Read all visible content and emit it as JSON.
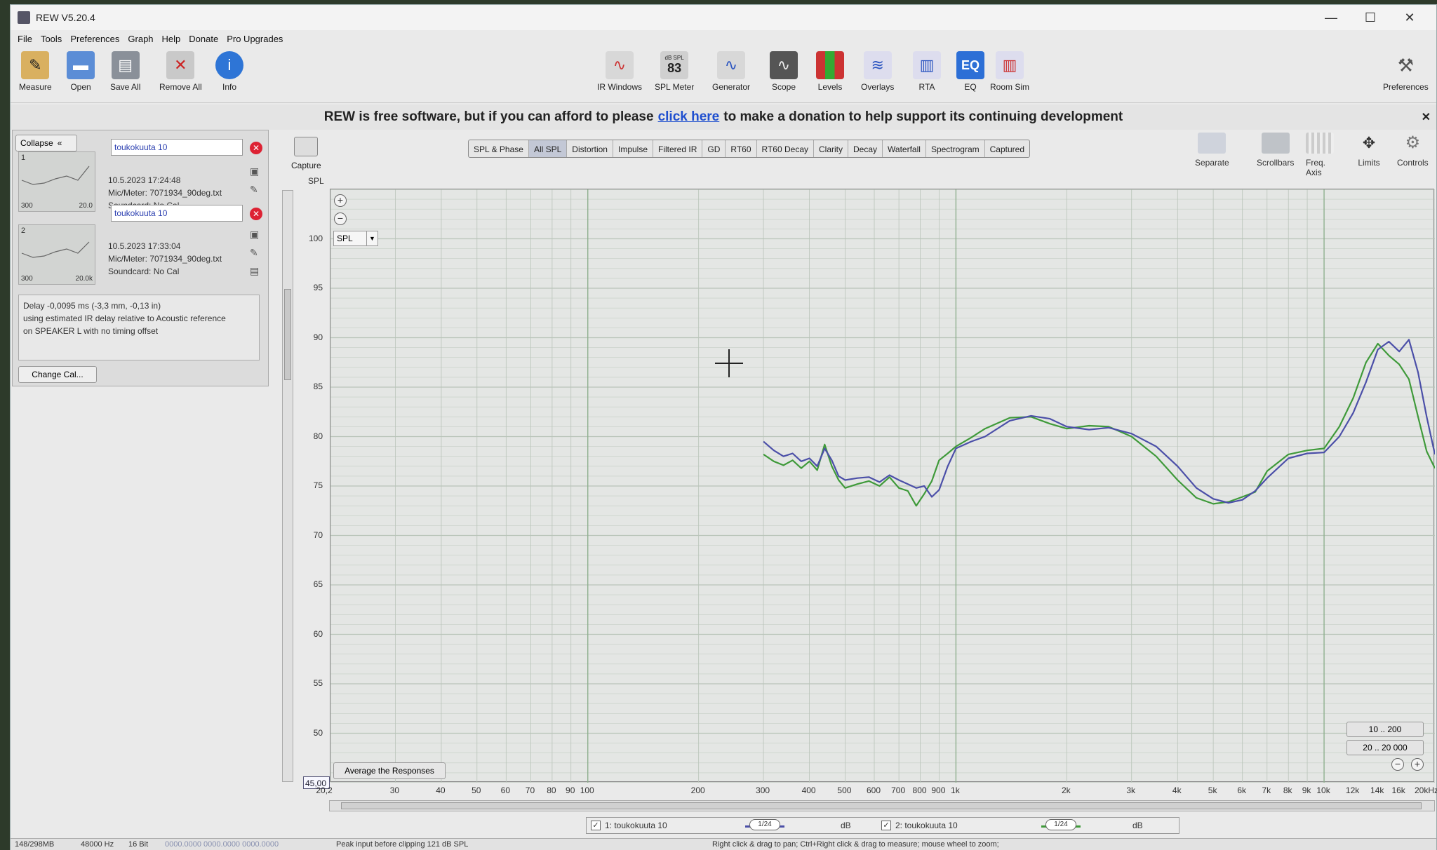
{
  "window": {
    "title": "REW V5.20.4",
    "controls": [
      "—",
      "☐",
      "✕"
    ]
  },
  "menu": [
    "File",
    "Tools",
    "Preferences",
    "Graph",
    "Help",
    "Donate",
    "Pro Upgrades"
  ],
  "toolbar": {
    "left": [
      {
        "label": "Measure",
        "icon": "measure-icon"
      },
      {
        "label": "Open",
        "icon": "folder-open-icon"
      },
      {
        "label": "Save All",
        "icon": "save-all-icon"
      },
      {
        "label": "Remove All",
        "icon": "remove-all-icon"
      },
      {
        "label": "Info",
        "icon": "info-icon"
      }
    ],
    "center": [
      {
        "label": "IR Windows",
        "icon": "ir-windows-icon"
      },
      {
        "label": "SPL Meter",
        "icon": "spl-meter-icon",
        "display_top": "dB SPL",
        "display_value": "83"
      },
      {
        "label": "Generator",
        "icon": "generator-icon"
      },
      {
        "label": "Scope",
        "icon": "scope-icon"
      },
      {
        "label": "Levels",
        "icon": "levels-icon"
      },
      {
        "label": "Overlays",
        "icon": "overlays-icon"
      },
      {
        "label": "RTA",
        "icon": "rta-icon"
      },
      {
        "label": "EQ",
        "icon": "eq-icon"
      },
      {
        "label": "Room Sim",
        "icon": "room-sim-icon"
      }
    ],
    "right": {
      "label": "Preferences",
      "icon": "wrench-icon"
    }
  },
  "banner": {
    "before": "REW is free software, but if you can afford to please",
    "link": "click here",
    "after": "to make a donation to help support its continuing development",
    "close": "✕"
  },
  "left_panel": {
    "collapse_label": "Collapse",
    "measurements": [
      {
        "index": "1",
        "name": "toukokuuta 10",
        "date": "10.5.2023 17:24:48",
        "mic": "Mic/Meter: 7071934_90deg.txt",
        "soundcard": "Soundcard: No Cal",
        "freq_lo": "300",
        "freq_hi": "20.0"
      },
      {
        "index": "2",
        "name": "toukokuuta 10",
        "date": "10.5.2023 17:33:04",
        "mic": "Mic/Meter: 7071934_90deg.txt",
        "soundcard": "Soundcard: No Cal",
        "freq_lo": "300",
        "freq_hi": "20.0k"
      }
    ],
    "note_lines": [
      "Delay -0,0095 ms (-3,3 mm, -0,13 in)",
      "using estimated IR delay relative to Acoustic reference",
      "on SPEAKER L with no timing offset"
    ],
    "change_cal_label": "Change Cal..."
  },
  "capture": {
    "label": "Capture"
  },
  "graph_tabs": [
    "SPL & Phase",
    "All SPL",
    "Distortion",
    "Impulse",
    "Filtered IR",
    "GD",
    "RT60",
    "RT60 Decay",
    "Clarity",
    "Decay",
    "Waterfall",
    "Spectrogram",
    "Captured"
  ],
  "active_tab": "All SPL",
  "right_tools": [
    {
      "label": "Separate",
      "icon": "separate-icon"
    },
    {
      "label": "Scrollbars",
      "icon": "scrollbars-icon"
    },
    {
      "label": "Freq. Axis",
      "icon": "freq-axis-icon"
    },
    {
      "label": "Limits",
      "icon": "limits-icon"
    },
    {
      "label": "Controls",
      "icon": "controls-gear-icon"
    }
  ],
  "graph": {
    "y_axis_title": "SPL",
    "spl_select": "SPL",
    "average_label": "Average the Responses",
    "range_buttons": [
      "10 .. 200",
      "20 .. 20 000"
    ],
    "x_min_value": "45,00",
    "x_first_label": "20,2"
  },
  "legend": [
    {
      "checked": "✓",
      "label": "1: toukokuuta 10",
      "smoothing": "1/24",
      "unit": "dB"
    },
    {
      "checked": "✓",
      "label": "2: toukokuuta 10",
      "smoothing": "1/24",
      "unit": "dB"
    }
  ],
  "status": {
    "memory": "148/298MB",
    "rate": "48000 Hz",
    "bits": "16 Bit",
    "meters": "0000.0000  0000.0000  0000.0000",
    "peak": "Peak input before clipping 121 dB SPL",
    "hint": "Right click & drag to pan; Ctrl+Right click & drag to measure; mouse wheel to zoom;"
  },
  "colors": {
    "series1": "#4b4fa8",
    "series2": "#3f9a3a",
    "grid": "#b9c4b9",
    "plot_bg": "#e4e6e4",
    "accent_link": "#1f4fcf"
  },
  "chart_data": {
    "type": "line",
    "title": "",
    "xlabel": "",
    "ylabel": "SPL",
    "x_scale": "log",
    "xlim": [
      20,
      20000
    ],
    "ylim": [
      45,
      105
    ],
    "x_tick_labels": [
      "30",
      "40",
      "50",
      "60",
      "70",
      "80",
      "90",
      "100",
      "200",
      "300",
      "400",
      "500",
      "600",
      "700",
      "800",
      "900",
      "1k",
      "2k",
      "3k",
      "4k",
      "5k",
      "6k",
      "7k",
      "8k",
      "9k",
      "10k",
      "12k",
      "14k",
      "16k",
      "20kHz"
    ],
    "y_tick_labels": [
      "100",
      "95",
      "90",
      "85",
      "80",
      "75",
      "70",
      "65",
      "60",
      "55",
      "50"
    ],
    "series": [
      {
        "name": "1: toukokuuta 10",
        "x": [
          300,
          320,
          340,
          360,
          380,
          400,
          420,
          440,
          460,
          480,
          500,
          540,
          580,
          620,
          660,
          700,
          740,
          780,
          820,
          860,
          900,
          950,
          1000,
          1100,
          1200,
          1400,
          1600,
          1800,
          2000,
          2300,
          2600,
          3000,
          3500,
          4000,
          4500,
          5000,
          5500,
          6000,
          6500,
          7000,
          8000,
          9000,
          10000,
          11000,
          12000,
          13000,
          14000,
          15000,
          16000,
          17000,
          18000,
          19000,
          20000
        ],
        "values": [
          79.5,
          78.6,
          78.0,
          78.3,
          77.5,
          77.8,
          77.0,
          78.8,
          77.6,
          76.0,
          75.6,
          75.8,
          75.9,
          75.4,
          76.1,
          75.6,
          75.2,
          74.8,
          75.0,
          73.9,
          74.6,
          77.0,
          78.8,
          79.5,
          80.0,
          81.6,
          82.1,
          81.8,
          81.0,
          80.7,
          80.9,
          80.3,
          79.0,
          77.0,
          74.8,
          73.7,
          73.3,
          73.6,
          74.5,
          75.8,
          77.8,
          78.3,
          78.4,
          80.0,
          82.4,
          85.5,
          88.8,
          89.6,
          88.6,
          89.8,
          86.5,
          82.0,
          78.2
        ]
      },
      {
        "name": "2: toukokuuta 10",
        "x": [
          300,
          320,
          340,
          360,
          380,
          400,
          420,
          440,
          460,
          480,
          500,
          540,
          580,
          620,
          660,
          700,
          740,
          780,
          820,
          860,
          900,
          950,
          1000,
          1100,
          1200,
          1400,
          1600,
          1800,
          2000,
          2300,
          2600,
          3000,
          3500,
          4000,
          4500,
          5000,
          5500,
          6000,
          6500,
          7000,
          8000,
          9000,
          10000,
          11000,
          12000,
          13000,
          14000,
          15000,
          16000,
          17000,
          18000,
          19000,
          20000
        ],
        "values": [
          78.2,
          77.5,
          77.1,
          77.6,
          76.8,
          77.5,
          76.6,
          79.2,
          77.0,
          75.6,
          74.8,
          75.2,
          75.5,
          75.0,
          75.9,
          74.8,
          74.5,
          73.0,
          74.2,
          75.5,
          77.6,
          78.3,
          79.0,
          79.9,
          80.8,
          81.9,
          82.0,
          81.3,
          80.8,
          81.1,
          81.0,
          80.0,
          78.0,
          75.6,
          73.8,
          73.2,
          73.4,
          73.9,
          74.4,
          76.5,
          78.2,
          78.6,
          78.8,
          81.0,
          83.9,
          87.5,
          89.4,
          88.2,
          87.3,
          85.8,
          82.0,
          78.5,
          76.8
        ]
      }
    ]
  }
}
